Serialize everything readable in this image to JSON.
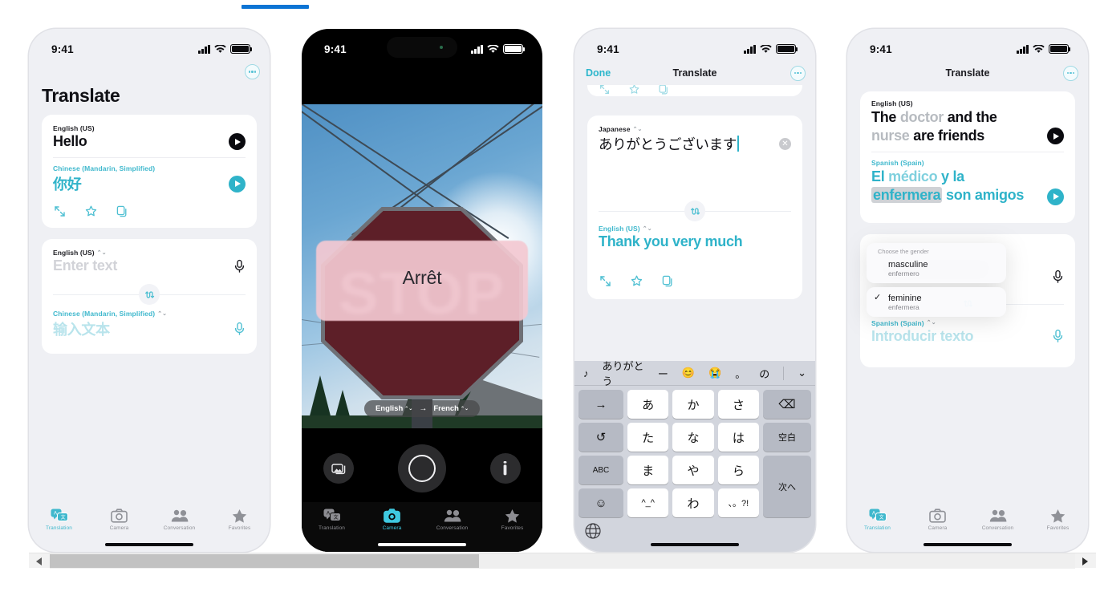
{
  "accent_color": "#2fb3c9",
  "blue_bar_color": "#0c74d4",
  "status_bar": {
    "time": "9:41"
  },
  "phone1": {
    "title": "Translate",
    "result_card": {
      "source_lang": "English (US)",
      "source_text": "Hello",
      "target_lang": "Chinese (Mandarin, Simplified)",
      "target_text": "你好",
      "actions": [
        "expand-icon",
        "star-icon",
        "copy-icon"
      ]
    },
    "entry_card": {
      "source_lang": "English (US)",
      "source_placeholder": "Enter text",
      "target_lang": "Chinese (Mandarin, Simplified)",
      "target_placeholder": "输入文本"
    },
    "tabs": [
      {
        "label": "Translation",
        "icon": "translation-icon",
        "active": true
      },
      {
        "label": "Camera",
        "icon": "camera-icon",
        "active": false
      },
      {
        "label": "Conversation",
        "icon": "conversation-icon",
        "active": false
      },
      {
        "label": "Favorites",
        "icon": "star-icon",
        "active": false
      }
    ]
  },
  "phone2": {
    "detected_text": "STOP",
    "overlay_text": "Arrêt",
    "lang_pill": {
      "source": "English",
      "arrow": "→",
      "target": "French"
    },
    "controls": [
      "photos-icon",
      "shutter-button",
      "flashlight-icon"
    ],
    "tabs": [
      {
        "label": "Translation",
        "icon": "translation-icon",
        "active": false
      },
      {
        "label": "Camera",
        "icon": "camera-icon",
        "active": true
      },
      {
        "label": "Conversation",
        "icon": "conversation-icon",
        "active": false
      },
      {
        "label": "Favorites",
        "icon": "star-icon",
        "active": false
      }
    ]
  },
  "phone3": {
    "nav": {
      "done": "Done",
      "title": "Translate",
      "menu": "ellipsis-icon"
    },
    "input_card": {
      "lang": "Japanese",
      "text": "ありがとうございます",
      "clear": "clear-icon"
    },
    "output_card": {
      "lang": "English (US)",
      "text": "Thank you very much",
      "actions": [
        "expand-icon",
        "star-icon",
        "copy-icon"
      ]
    },
    "keyboard": {
      "predictions": [
        "♪",
        "ありがとう",
        "ー",
        "😊",
        "😭",
        "。",
        "の"
      ],
      "collapse": "chevron-down-icon",
      "rows": [
        [
          {
            "label": "→",
            "style": "gray"
          },
          {
            "label": "あ",
            "style": "white"
          },
          {
            "label": "か",
            "style": "white"
          },
          {
            "label": "さ",
            "style": "white"
          },
          {
            "label": "⌫",
            "style": "gray"
          }
        ],
        [
          {
            "label": "↺",
            "style": "gray"
          },
          {
            "label": "た",
            "style": "white"
          },
          {
            "label": "な",
            "style": "white"
          },
          {
            "label": "は",
            "style": "white"
          },
          {
            "label": "空白",
            "style": "gray"
          }
        ],
        [
          {
            "label": "ABC",
            "style": "gray"
          },
          {
            "label": "ま",
            "style": "white"
          },
          {
            "label": "や",
            "style": "white"
          },
          {
            "label": "ら",
            "style": "white"
          },
          {
            "label": "次へ",
            "style": "gray"
          }
        ],
        [
          {
            "label": "☺",
            "style": "gray"
          },
          {
            "label": "^_^",
            "style": "white"
          },
          {
            "label": "わ",
            "style": "white"
          },
          {
            "label": "、。?!",
            "style": "white"
          }
        ]
      ],
      "globe": "globe-icon"
    }
  },
  "phone4": {
    "nav": {
      "title": "Translate",
      "menu": "ellipsis-icon"
    },
    "result_card": {
      "source_lang": "English (US)",
      "source_parts": [
        {
          "t": "The ",
          "style": "bold"
        },
        {
          "t": "doctor",
          "style": "dim"
        },
        {
          "t": " and the ",
          "style": "bold"
        },
        {
          "t": "nurse",
          "style": "dim"
        },
        {
          "t": " are friends",
          "style": "bold"
        }
      ],
      "target_lang": "Spanish (Spain)",
      "target_parts": [
        {
          "t": "El ",
          "style": "bold"
        },
        {
          "t": "médico",
          "style": "soft"
        },
        {
          "t": " y la ",
          "style": "bold"
        },
        {
          "t": "enfermera",
          "style": "highlight"
        },
        {
          "t": " son amigos",
          "style": "bold"
        }
      ]
    },
    "gender_popover": {
      "header": "Choose the gender",
      "options": [
        {
          "title": "masculine",
          "subtitle": "enfermero",
          "selected": false
        },
        {
          "title": "feminine",
          "subtitle": "enfermera",
          "selected": true
        }
      ]
    },
    "entry_card": {
      "target_lang": "Spanish (Spain)",
      "target_placeholder": "Introducir texto"
    },
    "tabs": [
      {
        "label": "Translation",
        "icon": "translation-icon",
        "active": true
      },
      {
        "label": "Camera",
        "icon": "camera-icon",
        "active": false
      },
      {
        "label": "Conversation",
        "icon": "conversation-icon",
        "active": false
      },
      {
        "label": "Favorites",
        "icon": "star-icon",
        "active": false
      }
    ]
  }
}
